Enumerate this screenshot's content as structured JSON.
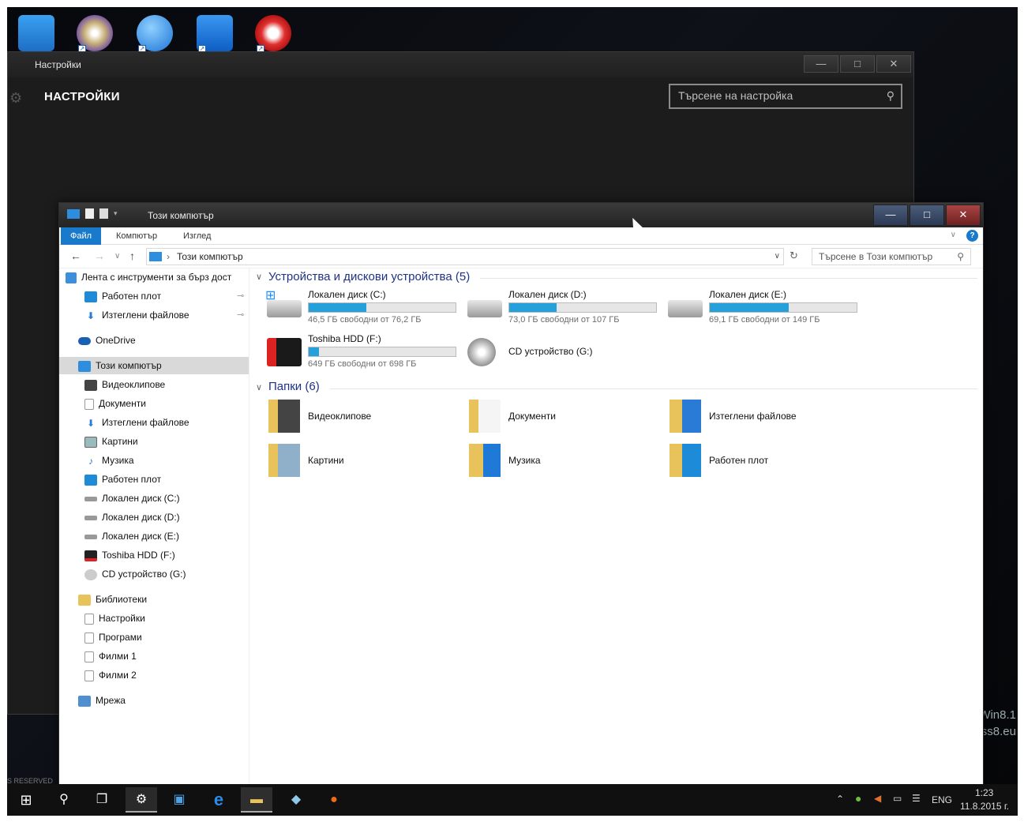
{
  "desktop": {
    "icons": [
      {
        "name": "this-pc",
        "color": "#2d8ee0"
      },
      {
        "name": "dvd-installer",
        "color": "#c9b27a"
      },
      {
        "name": "flash-app",
        "color": "#2a8be8"
      },
      {
        "name": "teamviewer",
        "color": "#1877e6"
      },
      {
        "name": "ccleaner",
        "color": "#d33"
      }
    ],
    "watermark_line1": "Win8.1",
    "watermark_line2": "ss8.eu",
    "reserved": "S RESERVED"
  },
  "settings": {
    "title": "Настройки",
    "heading": "НАСТРОЙКИ",
    "search_placeholder": "Търсене на настройка",
    "min": "—",
    "max": "□",
    "close": "✕"
  },
  "explorer": {
    "title": "Този компютър",
    "min": "—",
    "max": "□",
    "close": "✕",
    "ribbon": {
      "file": "Файл",
      "computer": "Компютър",
      "view": "Изглед"
    },
    "address": "Този компютър",
    "search_placeholder": "Търсене в Този компютър",
    "nav": {
      "quick": "Лента с инструменти за бърз дост",
      "desktop_pin": "Работен плот",
      "downloads_pin": "Изтеглени файлове",
      "onedrive": "OneDrive",
      "thispc": "Този компютър",
      "videos": "Видеоклипове",
      "documents": "Документи",
      "downloads": "Изтеглени файлове",
      "pictures": "Картини",
      "music": "Музика",
      "desktop": "Работен плот",
      "c": "Локален диск (C:)",
      "d": "Локален диск (D:)",
      "e": "Локален диск (E:)",
      "f": "Toshiba HDD (F:)",
      "g": "CD устройство (G:)",
      "libraries": "Библиотеки",
      "lib_settings": "Настройки",
      "lib_programs": "Програми",
      "lib_films1": "Филми 1",
      "lib_films2": "Филми 2",
      "network": "Мрежа"
    },
    "devices_header": "Устройства и дискови устройства (5)",
    "drives": [
      {
        "name": "Локален диск (C:)",
        "free": "46,5 ГБ свободни от 76,2 ГБ",
        "used": 0.39
      },
      {
        "name": "Локален диск (D:)",
        "free": "73,0 ГБ свободни от 107 ГБ",
        "used": 0.32
      },
      {
        "name": "Локален диск (E:)",
        "free": "69,1 ГБ свободни от 149 ГБ",
        "used": 0.54
      },
      {
        "name": "Toshiba HDD (F:)",
        "free": "649 ГБ свободни от 698 ГБ",
        "used": 0.07
      },
      {
        "name": "CD устройство (G:)"
      }
    ],
    "folders_header": "Папки (6)",
    "folders": [
      "Видеоклипове",
      "Документи",
      "Изтеглени файлове",
      "Картини",
      "Музика",
      "Работен плот"
    ]
  },
  "taskbar": {
    "lang": "ENG",
    "time": "1:23",
    "date": "11.8.2015 г."
  }
}
